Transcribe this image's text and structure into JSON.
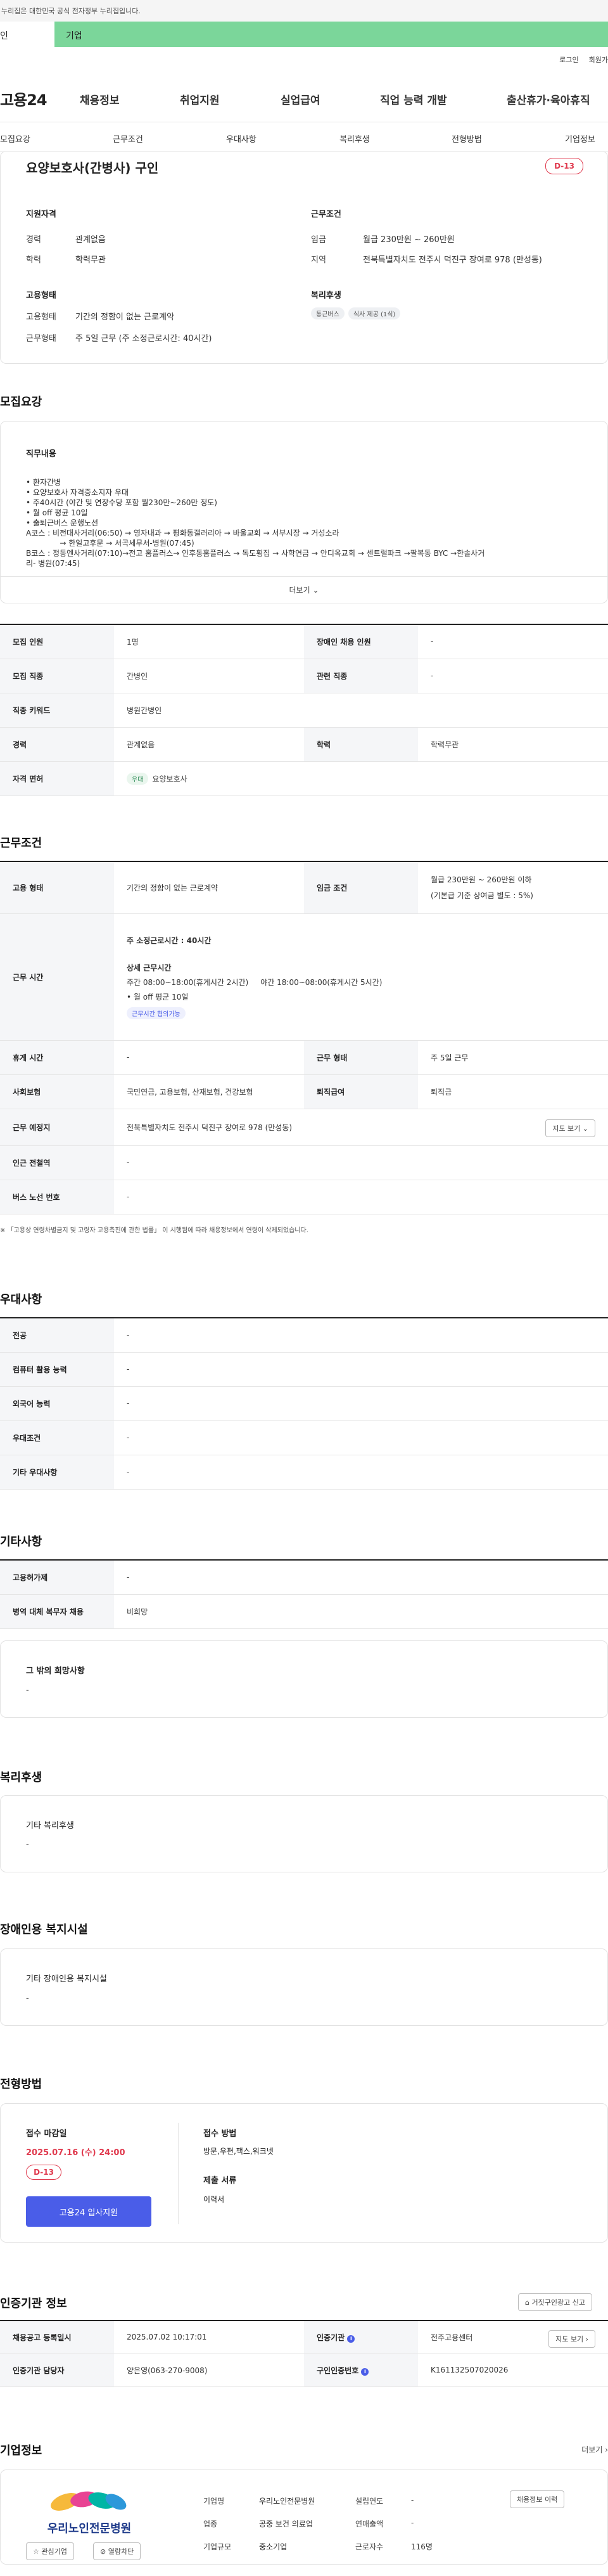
{
  "top": {
    "gov_notice": "누리집은 대한민국 공식 전자정부 누리집입니다.",
    "tab_personal": "인",
    "tab_company": "기업",
    "login": "로그인",
    "join": "회원가"
  },
  "gnb": {
    "logo": "고용24",
    "items": [
      "채용정보",
      "취업지원",
      "실업급여",
      "직업 능력 개발",
      "출산휴가·육아휴직"
    ]
  },
  "subnav": {
    "items": [
      "모집요강",
      "근무조건",
      "우대사항",
      "복리후생",
      "전형방법",
      "기업정보"
    ]
  },
  "summary": {
    "title": "요양보호사(간병사) 구인",
    "dday": "D-13",
    "qual_title": "지원자격",
    "career_lbl": "경력",
    "career_val": "관계없음",
    "edu_lbl": "학력",
    "edu_val": "학력무관",
    "cond_title": "근무조건",
    "wage_lbl": "임금",
    "wage_val": "월급 230만원 ~ 260만원",
    "region_lbl": "지역",
    "region_val": "전북특별자치도 전주시 덕진구 장여로 978 (만성동)",
    "emp_title": "고용형태",
    "emptype_lbl": "고용형태",
    "emptype_val": "기간의 정함이 없는 근로계약",
    "worktype_lbl": "근무형태",
    "worktype_val": "주 5일 근무 (주 소정근로시간: 40시간)",
    "welfare_title": "복리후생",
    "welfare_tags": [
      "통근버스",
      "식사 제공 (1식)"
    ]
  },
  "recruit": {
    "heading": "모집요강",
    "duty_title": "직무내용",
    "duty_lines": [
      "• 환자간병",
      "• 요양보호사 자격증소지자 우대",
      "• 주40시간 (야간 및 연장수당 포함 월230만~260만 정도)",
      "• 월 off 평균 10일",
      "• 출퇴근버스 운행노선",
      "A코스 : 비전대사거리(06:50) → 영자내과 → 평화동갤러리아 → 바울교회 → 서부시장 → 거성소라",
      "              → 한일고후문 → 서곡세무서-병원(07:45)",
      "B코스 : 정동엔사거리(07:10)→전고 홈플러스→ 인후동홈플러스 → 독도횡집 → 사학연금 → 안디옥교회 → 센트럴파크 →팔복동 BYC →한솔사거",
      "리- 병원(07:45)"
    ],
    "more": "더보기",
    "rows": [
      {
        "k": "모집 인원",
        "v": "1명",
        "k2": "장애인 채용 인원",
        "v2": "-"
      },
      {
        "k": "모집 직종",
        "v": "간병인",
        "k2": "관련 직종",
        "v2": "-"
      },
      {
        "k": "직종 키워드",
        "v": "병원간병인"
      },
      {
        "k": "경력",
        "v": "관계없음",
        "k2": "학력",
        "v2": "학력무관"
      },
      {
        "k": "자격 면허",
        "tag": "우대",
        "v": "요양보호사"
      }
    ]
  },
  "work": {
    "heading": "근무조건",
    "emptype_k": "고용 형태",
    "emptype_v": "기간의 정함이 없는 근로계약",
    "wage_k": "임금 조건",
    "wage_v1": "월급 230만원 ~ 260만원 이하",
    "wage_v2": "(기본급 기준 상여금 별도 : 5%)",
    "hours_k": "근무 시간",
    "hours_main_lbl": "주 소정근로시간",
    "hours_main_val": " : 40시간",
    "hours_detail_title": "상세 근무시간",
    "hours_detail": "주간 08:00~18:00(휴게시간 2시간)     야간 18:00~08:00(휴게시간 5시간)",
    "hours_off": "• 월 off 평균 10일",
    "hours_tag": "근무시간 협의가능",
    "break_k": "휴게 시간",
    "break_v": "-",
    "form_k": "근무 형태",
    "form_v": "주 5일 근무",
    "ins_k": "사회보험",
    "ins_v": "국민연금, 고용보험, 산재보험, 건강보험",
    "retire_k": "퇴직급여",
    "retire_v": "퇴직금",
    "place_k": "근무 예정지",
    "place_v": "전북특별자치도 전주시 덕진구 장여로 978 (만성동)",
    "map_btn": "지도 보기",
    "station_k": "인근 전철역",
    "station_v": "-",
    "bus_k": "버스 노선 번호",
    "bus_v": "-",
    "note": "「고용상 연령차별금지 및 고령자 고용촉진에 관한 법률」 이 시행됨에 따라 채용정보에서 연령이 삭제되었습니다."
  },
  "pref": {
    "heading": "우대사항",
    "rows": [
      {
        "k": "전공",
        "v": "-"
      },
      {
        "k": "컴퓨터 활용 능력",
        "v": "-"
      },
      {
        "k": "외국어 능력",
        "v": "-"
      },
      {
        "k": "우대조건",
        "v": "-"
      },
      {
        "k": "기타 우대사항",
        "v": "-"
      }
    ]
  },
  "etc": {
    "heading": "기타사항",
    "rows": [
      {
        "k": "고용허가제",
        "v": "-"
      },
      {
        "k": "병역 대체 복무자 채용",
        "v": "비희망"
      }
    ],
    "req_title": "그 밖의 희망사항",
    "req_val": "-"
  },
  "benefit": {
    "heading": "복리후생",
    "title": "기타 복리후생",
    "val": "-"
  },
  "disabled": {
    "heading": "장애인용 복지시설",
    "title": "기타 장애인용 복지시설",
    "val": "-"
  },
  "process": {
    "heading": "전형방법",
    "deadline_title": "접수 마감일",
    "deadline": "2025.07.16 (수) 24:00",
    "dday": "D-13",
    "apply_btn": "고용24 입사지원",
    "method_title": "접수 방법",
    "method_val": "방문,우편,팩스,워크넷",
    "docs_title": "제출 서류",
    "docs_val": "이력서"
  },
  "cert": {
    "heading": "인증기관 정보",
    "report_btn": "거짓구인광고 신고",
    "date_k": "채용공고 등록일시",
    "date_v": "2025.07.02 10:17:01",
    "agency_k": "인증기관",
    "agency_v": "전주고용센터",
    "map_btn": "지도 보기",
    "manager_k": "인증기관 담당자",
    "manager_v": "양은영(063-270-9008)",
    "no_k": "구인인증번호",
    "no_v": "K161132507020026"
  },
  "company": {
    "heading": "기업정보",
    "more": "더보기",
    "logo_text": "우리노인전문병원",
    "fav_btn": "관심기업",
    "block_btn": "열람차단",
    "name_k": "기업명",
    "name_v": "우리노인전문병원",
    "year_k": "설립연도",
    "year_v": "-",
    "job_btn": "채용정보 이력",
    "ind_k": "업종",
    "ind_v": "공중 보건 의료업",
    "sales_k": "연매출액",
    "sales_v": "-",
    "size_k": "기업규모",
    "size_v": "중소기업",
    "emp_k": "근로자수",
    "emp_v": "116명"
  },
  "colors": {
    "accent": "#4a5de8",
    "dday": "#e03a4e",
    "green": "#7bd69a"
  }
}
